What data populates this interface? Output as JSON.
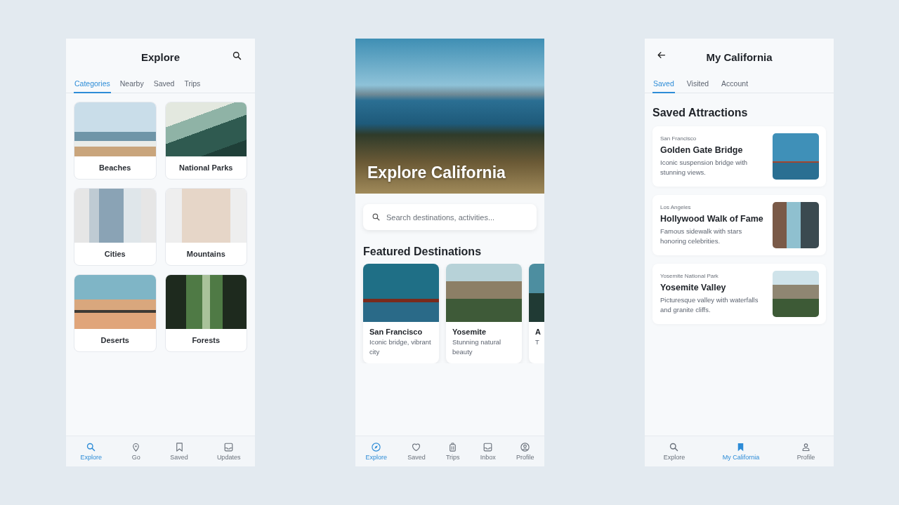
{
  "screens": [
    {
      "kind": "explore",
      "title": "Explore",
      "tabs": [
        {
          "label": "Categories",
          "selected": true
        },
        {
          "label": "Nearby",
          "selected": false
        },
        {
          "label": "Saved",
          "selected": false
        },
        {
          "label": "Trips",
          "selected": false
        }
      ],
      "categories": [
        {
          "label": "Beaches"
        },
        {
          "label": "National Parks"
        },
        {
          "label": "Cities"
        },
        {
          "label": "Mountains"
        },
        {
          "label": "Deserts"
        },
        {
          "label": "Forests"
        }
      ],
      "nav": [
        {
          "label": "Explore",
          "selected": true
        },
        {
          "label": "Go",
          "selected": false
        },
        {
          "label": "Saved",
          "selected": false
        },
        {
          "label": "Updates",
          "selected": false
        }
      ]
    },
    {
      "kind": "home",
      "hero_title": "Explore California",
      "search": {
        "placeholder": "Search destinations, activities..."
      },
      "section_title": "Featured Destinations",
      "featured": [
        {
          "title": "San Francisco",
          "description": "Iconic bridge, vibrant city"
        },
        {
          "title": "Yosemite",
          "description": "Stunning natural beauty"
        },
        {
          "title": "A",
          "description": "T"
        }
      ],
      "nav": [
        {
          "label": "Explore",
          "selected": true
        },
        {
          "label": "Saved",
          "selected": false
        },
        {
          "label": "Trips",
          "selected": false
        },
        {
          "label": "Inbox",
          "selected": false
        },
        {
          "label": "Profile",
          "selected": false
        }
      ]
    },
    {
      "kind": "profile",
      "title": "My California",
      "tabs": [
        {
          "label": "Saved",
          "selected": true
        },
        {
          "label": "Visited",
          "selected": false
        },
        {
          "label": "Account",
          "selected": false
        }
      ],
      "section_title": "Saved Attractions",
      "attractions": [
        {
          "location": "San Francisco",
          "name": "Golden Gate Bridge",
          "description": "Iconic suspension bridge with stunning views."
        },
        {
          "location": "Los Angeles",
          "name": "Hollywood Walk of Fame",
          "description": "Famous sidewalk with stars honoring celebrities."
        },
        {
          "location": "Yosemite National Park",
          "name": "Yosemite Valley",
          "description": "Picturesque valley with waterfalls and granite cliffs."
        }
      ],
      "nav": [
        {
          "label": "Explore",
          "selected": false
        },
        {
          "label": "My California",
          "selected": true
        },
        {
          "label": "Profile",
          "selected": false
        }
      ]
    }
  ]
}
